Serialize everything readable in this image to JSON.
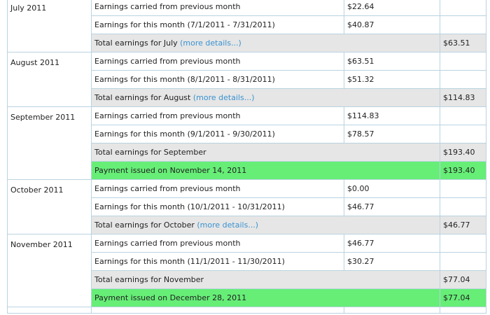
{
  "months": [
    {
      "label": "July 2011",
      "carried_label": "Earnings carried from previous month",
      "carried_amount": "$22.64",
      "this_label": "Earnings for this month (7/1/2011 - 7/31/2011)",
      "this_amount": "$40.87",
      "total_label": "Total earnings for July",
      "more_label": "(more details...)",
      "total_amount": "$63.51"
    },
    {
      "label": "August 2011",
      "carried_label": "Earnings carried from previous month",
      "carried_amount": "$63.51",
      "this_label": "Earnings for this month (8/1/2011 - 8/31/2011)",
      "this_amount": "$51.32",
      "total_label": "Total earnings for August",
      "more_label": "(more details...)",
      "total_amount": "$114.83"
    },
    {
      "label": "September 2011",
      "carried_label": "Earnings carried from previous month",
      "carried_amount": "$114.83",
      "this_label": "Earnings for this month (9/1/2011 - 9/30/2011)",
      "this_amount": "$78.57",
      "total_label": "Total earnings for September",
      "total_amount": "$193.40",
      "payment_label": "Payment issued on November 14, 2011",
      "payment_amount": "$193.40"
    },
    {
      "label": "October 2011",
      "carried_label": "Earnings carried from previous month",
      "carried_amount": "$0.00",
      "this_label": "Earnings for this month (10/1/2011 - 10/31/2011)",
      "this_amount": "$46.77",
      "total_label": "Total earnings for October",
      "more_label": "(more details...)",
      "total_amount": "$46.77"
    },
    {
      "label": "November 2011",
      "carried_label": "Earnings carried from previous month",
      "carried_amount": "$46.77",
      "this_label": "Earnings for this month (11/1/2011 - 11/30/2011)",
      "this_amount": "$30.27",
      "total_label": "Total earnings for November",
      "total_amount": "$77.04",
      "payment_label": "Payment issued on December 28, 2011",
      "payment_amount": "$77.04"
    }
  ],
  "colors": {
    "border": "#b9d3df",
    "total_row_bg": "#e6e6e6",
    "payment_row_bg": "#66ee77",
    "link": "#3a92d0"
  }
}
